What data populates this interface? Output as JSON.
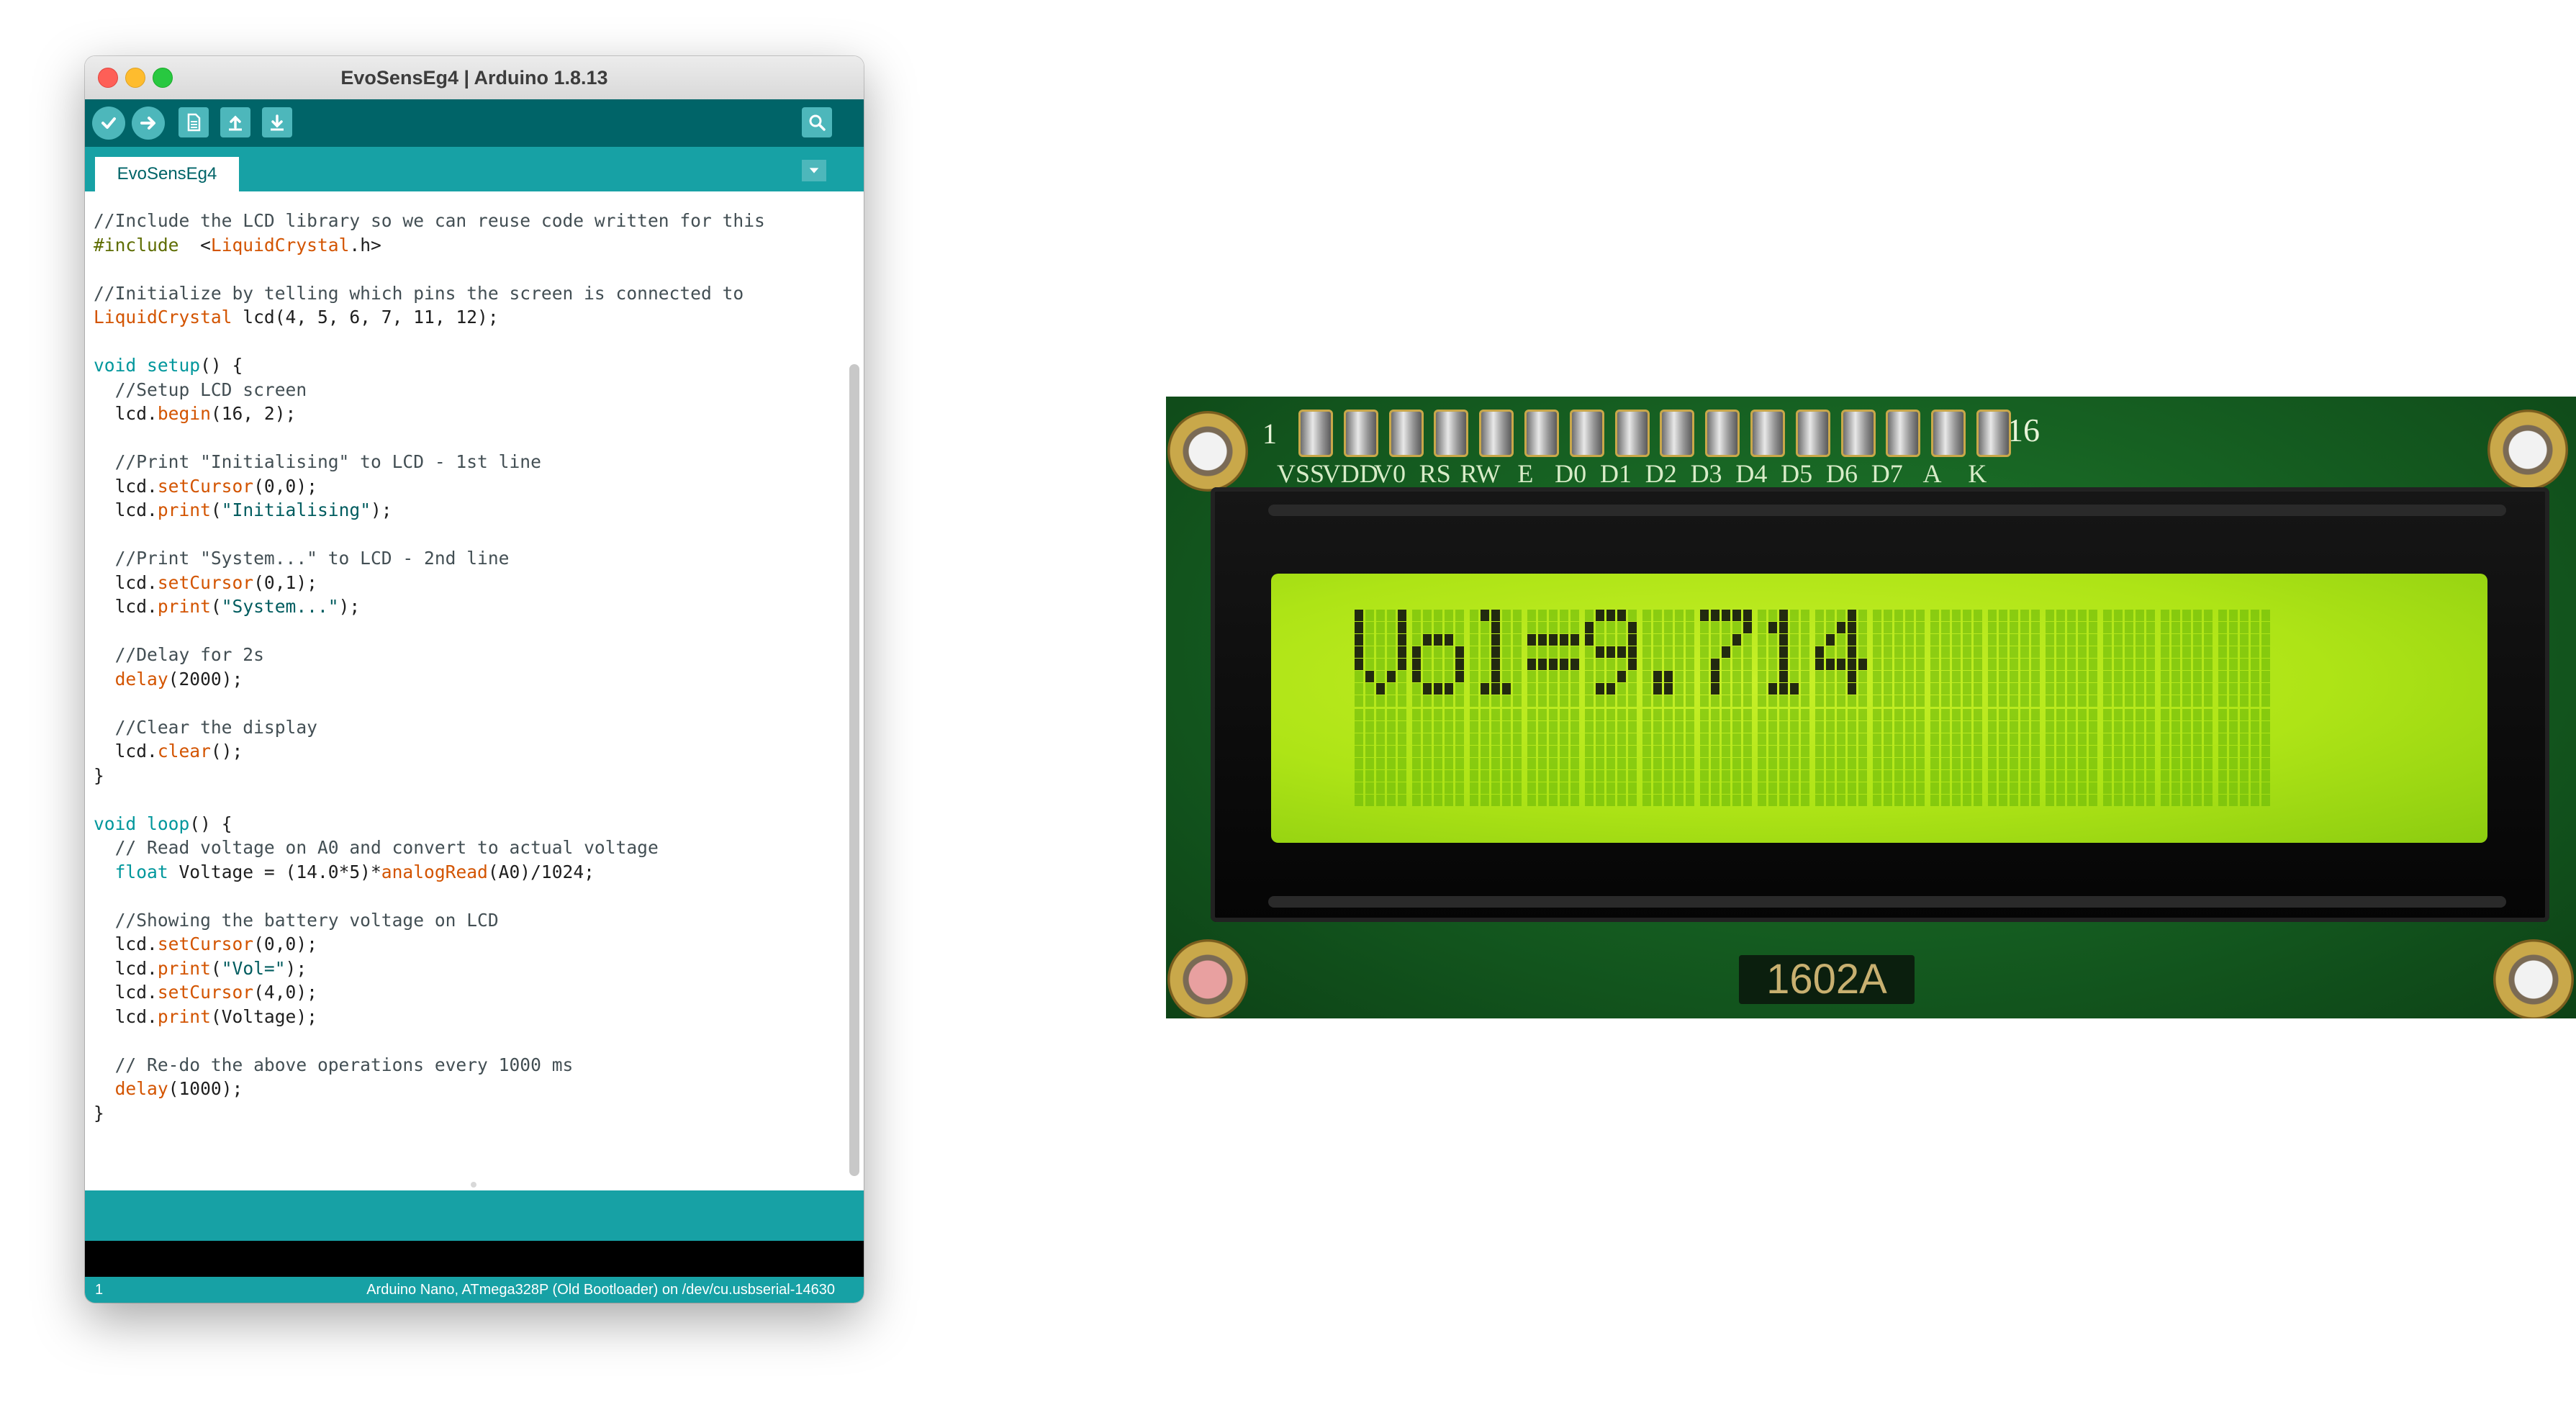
{
  "window": {
    "title": "EvoSensEg4 | Arduino 1.8.13"
  },
  "toolbar": {
    "verify": "check-icon",
    "upload": "arrow-right-icon",
    "new": "new-file-icon",
    "open": "open-arrow-up-icon",
    "save": "save-arrow-down-icon",
    "serial_monitor": "magnifier-icon"
  },
  "tabs": [
    {
      "label": "EvoSensEg4"
    }
  ],
  "colors": {
    "toolbar": "#006468",
    "tabbar": "#17a1a5",
    "comment": "#434f54",
    "keyword": "#00979c",
    "function": "#d35400",
    "preprocessor": "#5e6d03",
    "lcd_backlight": "#aee416"
  },
  "code_lines": [
    [
      [
        "c-cm",
        "//Include the LCD library so we can reuse code written for this"
      ]
    ],
    [
      [
        "c-pre",
        "#include"
      ],
      [
        "",
        "  <"
      ],
      [
        "c-fn",
        "LiquidCrystal"
      ],
      [
        "",
        ".h>"
      ]
    ],
    [],
    [
      [
        "c-cm",
        "//Initialize by telling which pins the screen is connected to"
      ]
    ],
    [
      [
        "c-fn",
        "LiquidCrystal"
      ],
      [
        "",
        " lcd(4, 5, 6, 7, 11, 12);"
      ]
    ],
    [],
    [
      [
        "c-kw",
        "void"
      ],
      [
        "",
        " "
      ],
      [
        "c-kw",
        "setup"
      ],
      [
        "",
        "() {"
      ]
    ],
    [
      [
        "c-cm",
        "  //Setup LCD screen"
      ]
    ],
    [
      [
        "",
        "  lcd."
      ],
      [
        "c-fn",
        "begin"
      ],
      [
        "",
        "(16, 2);"
      ]
    ],
    [],
    [
      [
        "c-cm",
        "  //Print \"Initialising\" to LCD - 1st line"
      ]
    ],
    [
      [
        "",
        "  lcd."
      ],
      [
        "c-fn",
        "setCursor"
      ],
      [
        "",
        "(0,0);"
      ]
    ],
    [
      [
        "",
        "  lcd."
      ],
      [
        "c-fn",
        "print"
      ],
      [
        "",
        "("
      ],
      [
        "c-str",
        "\"Initialising\""
      ],
      [
        "",
        ");"
      ]
    ],
    [],
    [
      [
        "c-cm",
        "  //Print \"System...\" to LCD - 2nd line"
      ]
    ],
    [
      [
        "",
        "  lcd."
      ],
      [
        "c-fn",
        "setCursor"
      ],
      [
        "",
        "(0,1);"
      ]
    ],
    [
      [
        "",
        "  lcd."
      ],
      [
        "c-fn",
        "print"
      ],
      [
        "",
        "("
      ],
      [
        "c-str",
        "\"System...\""
      ],
      [
        "",
        ");"
      ]
    ],
    [],
    [
      [
        "c-cm",
        "  //Delay for 2s"
      ]
    ],
    [
      [
        "c-fn",
        "  delay"
      ],
      [
        "",
        "(2000);"
      ]
    ],
    [],
    [
      [
        "c-cm",
        "  //Clear the display"
      ]
    ],
    [
      [
        "",
        "  lcd."
      ],
      [
        "c-fn",
        "clear"
      ],
      [
        "",
        "();"
      ]
    ],
    [
      [
        "",
        "}"
      ]
    ],
    [],
    [
      [
        "c-kw",
        "void"
      ],
      [
        "",
        " "
      ],
      [
        "c-kw",
        "loop"
      ],
      [
        "",
        "() {"
      ]
    ],
    [
      [
        "c-cm",
        "  // Read voltage on A0 and convert to actual voltage"
      ]
    ],
    [
      [
        "c-kw",
        "  float"
      ],
      [
        "",
        " Voltage = (14.0*5)*"
      ],
      [
        "c-fn",
        "analogRead"
      ],
      [
        "",
        "(A0)/1024;"
      ]
    ],
    [],
    [
      [
        "c-cm",
        "  //Showing the battery voltage on LCD"
      ]
    ],
    [
      [
        "",
        "  lcd."
      ],
      [
        "c-fn",
        "setCursor"
      ],
      [
        "",
        "(0,0);"
      ]
    ],
    [
      [
        "",
        "  lcd."
      ],
      [
        "c-fn",
        "print"
      ],
      [
        "",
        "("
      ],
      [
        "c-str",
        "\"Vol=\""
      ],
      [
        "",
        ");"
      ]
    ],
    [
      [
        "",
        "  lcd."
      ],
      [
        "c-fn",
        "setCursor"
      ],
      [
        "",
        "(4,0);"
      ]
    ],
    [
      [
        "",
        "  lcd."
      ],
      [
        "c-fn",
        "print"
      ],
      [
        "",
        "(Voltage);"
      ]
    ],
    [],
    [
      [
        "c-cm",
        "  // Re-do the above operations every 1000 ms"
      ]
    ],
    [
      [
        "c-fn",
        "  delay"
      ],
      [
        "",
        "(1000);"
      ]
    ],
    [
      [
        "",
        "}"
      ]
    ]
  ],
  "footer": {
    "line_number": "1",
    "board_info": "Arduino Nano, ATmega328P (Old Bootloader) on /dev/cu.usbserial-14630"
  },
  "lcd_module": {
    "pin1_label": "1",
    "pin16_label": "16",
    "pin_names": [
      "VSS",
      "VDD",
      "V0",
      "RS",
      "RW",
      "E",
      "D0",
      "D1",
      "D2",
      "D3",
      "D4",
      "D5",
      "D6",
      "D7",
      "A",
      "K"
    ],
    "model": "1602A",
    "row1_text": "Vol=9.714",
    "row2_text": ""
  }
}
